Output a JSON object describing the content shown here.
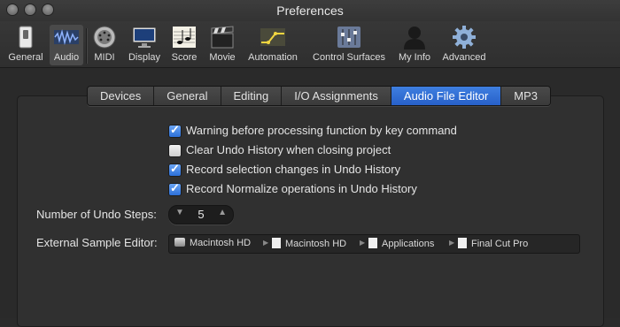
{
  "window": {
    "title": "Preferences"
  },
  "toolbar": {
    "items": [
      {
        "label": "General",
        "icon": "switch-icon"
      },
      {
        "label": "Audio",
        "icon": "waveform-icon"
      },
      {
        "label": "MIDI",
        "icon": "midi-connector-icon"
      },
      {
        "label": "Display",
        "icon": "monitor-icon"
      },
      {
        "label": "Score",
        "icon": "music-notes-icon"
      },
      {
        "label": "Movie",
        "icon": "clapperboard-icon"
      },
      {
        "label": "Automation",
        "icon": "automation-curve-icon"
      },
      {
        "label": "Control Surfaces",
        "icon": "faders-icon"
      },
      {
        "label": "My Info",
        "icon": "person-icon"
      },
      {
        "label": "Advanced",
        "icon": "gear-icon"
      }
    ],
    "selected": "Audio"
  },
  "tabs": {
    "items": [
      "Devices",
      "General",
      "Editing",
      "I/O Assignments",
      "Audio File Editor",
      "MP3"
    ],
    "active": "Audio File Editor"
  },
  "options": [
    {
      "label": "Warning before processing function by key command",
      "checked": true
    },
    {
      "label": "Clear Undo History when closing project",
      "checked": false
    },
    {
      "label": "Record selection changes in Undo History",
      "checked": true
    },
    {
      "label": "Record Normalize operations in Undo History",
      "checked": true
    }
  ],
  "undo_steps": {
    "label": "Number of Undo Steps:",
    "value": "5"
  },
  "external_editor": {
    "label": "External Sample Editor:",
    "path": [
      "Macintosh HD",
      "Macintosh HD",
      "Applications",
      "Final Cut Pro"
    ]
  },
  "colors": {
    "accent": "#2f6fd6",
    "background": "#2b2b2b"
  }
}
